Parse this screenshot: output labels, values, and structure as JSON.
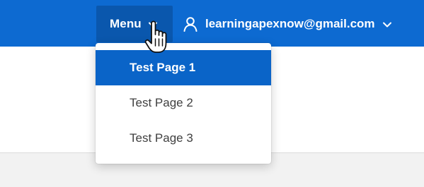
{
  "header": {
    "menu_label": "Menu",
    "user_email": "learningapexnow@gmail.com"
  },
  "dropdown": {
    "items": [
      {
        "label": "Test Page 1",
        "active": true
      },
      {
        "label": "Test Page 2",
        "active": false
      },
      {
        "label": "Test Page 3",
        "active": false
      }
    ]
  },
  "icons": {
    "menu_chevron": "chevron-down-icon",
    "user": "user-icon",
    "user_chevron": "chevron-down-icon",
    "cursor": "hand-pointer-cursor-icon"
  },
  "colors": {
    "header_bg": "#0d6ad1",
    "menu_button_bg": "#0a57ad",
    "active_item_bg": "#0a64c8",
    "item_text": "#404040",
    "page_bg": "#f2f2f2"
  }
}
